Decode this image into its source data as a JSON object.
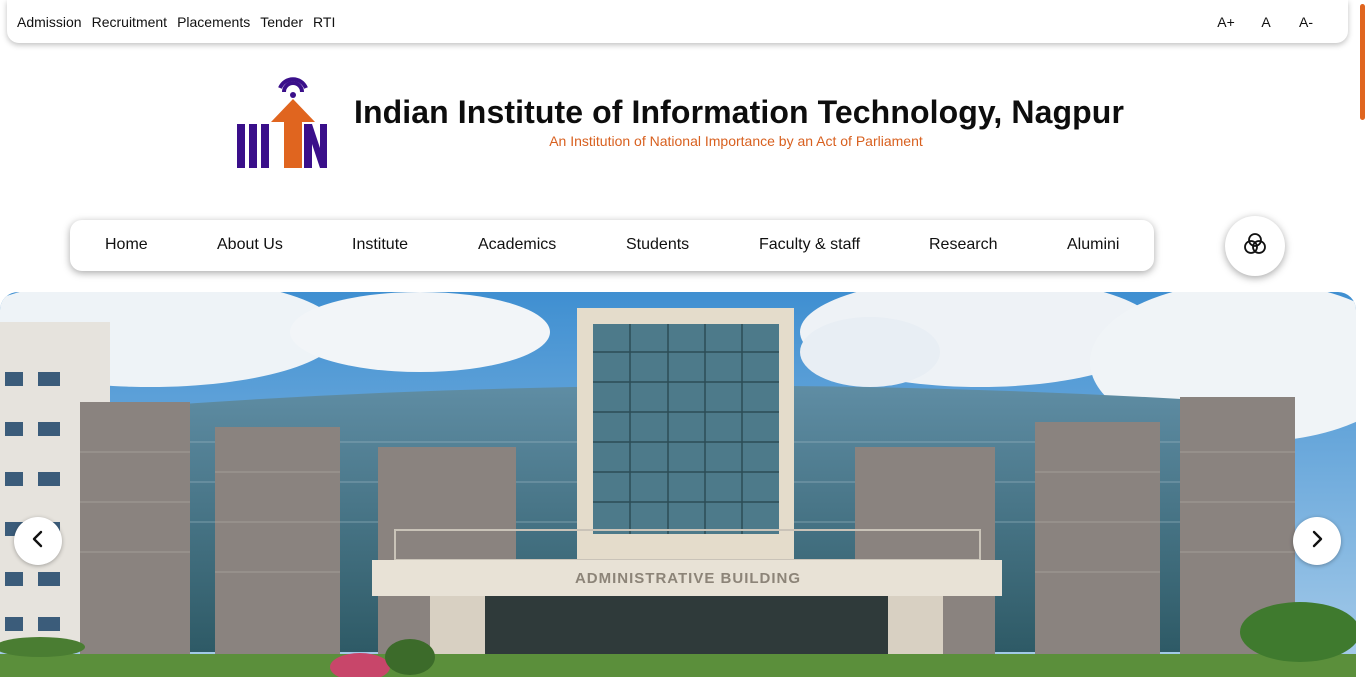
{
  "topbar": {
    "links": [
      "Admission",
      "Recruitment",
      "Placements",
      "Tender",
      "RTI"
    ],
    "font_controls": [
      "A+",
      "A",
      "A-"
    ]
  },
  "header": {
    "title": "Indian Institute of Information Technology, Nagpur",
    "subtitle": "An Institution of National Importance by an Act of Parliament",
    "logo_text": "IIITN"
  },
  "nav": {
    "items": [
      "Home",
      "About Us",
      "Institute",
      "Academics",
      "Students",
      "Faculty & staff",
      "Research",
      "Alumini"
    ]
  },
  "hero": {
    "building_sign": "ADMINISTRATIVE BUILDING"
  },
  "icons": {
    "theme": "palette-circles-icon",
    "prev": "chevron-left-icon",
    "next": "chevron-right-icon"
  },
  "colors": {
    "accent_orange": "#e0651f",
    "logo_purple": "#3a0f8a",
    "sky": "#5a9fd6"
  }
}
